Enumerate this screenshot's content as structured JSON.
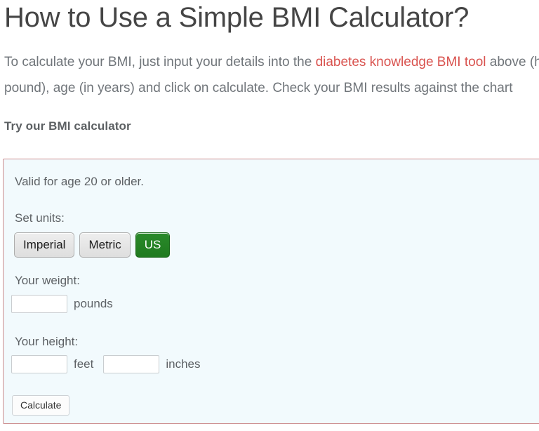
{
  "article": {
    "title": "How to Use a Simple BMI Calculator?",
    "intro_line1_before_link": "To calculate your BMI, just input your details into the ",
    "intro_link_text": "diabetes knowledge BMI tool",
    "intro_line1_after_link": " above (height in feet and inches, weight in",
    "intro_line2": "pound), age (in years) and click on calculate. Check your BMI results against the chart",
    "try_heading": "Try our BMI calculator"
  },
  "calculator": {
    "note": "Valid for age 20 or older.",
    "units_label": "Set units:",
    "unit_buttons": [
      {
        "label": "Imperial",
        "selected": false
      },
      {
        "label": "Metric",
        "selected": false
      },
      {
        "label": "US",
        "selected": true
      }
    ],
    "weight": {
      "label": "Your weight:",
      "value": "",
      "unit": "pounds"
    },
    "height": {
      "label": "Your height:",
      "feet_value": "",
      "feet_unit": "feet",
      "inches_value": "",
      "inches_unit": "inches"
    },
    "submit_label": "Calculate"
  },
  "colors": {
    "link_red": "#d9534f",
    "panel_border": "#cc8a8c",
    "panel_background": "#f2fafd",
    "selected_button_green": "#237a23",
    "heading_text": "#454545",
    "body_text": "#70757a"
  }
}
